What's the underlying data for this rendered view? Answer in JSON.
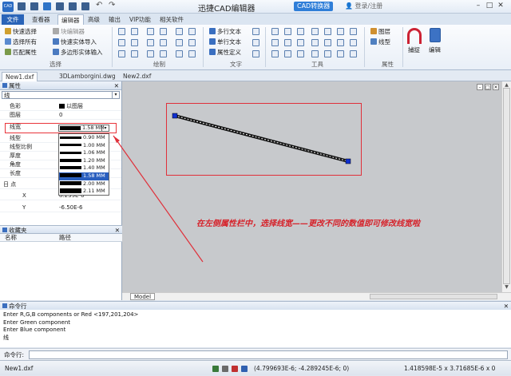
{
  "title_bar": {
    "app_icon_label": "CAD",
    "title": "迅捷CAD编辑器",
    "convert_button": "CAD转换器",
    "login": "登录/注册",
    "minimize": "–",
    "maximize": "□",
    "close": "✕"
  },
  "menu_tabs": [
    "文件",
    "查看器",
    "编辑器",
    "高级",
    "输出",
    "VIP功能",
    "相关软件"
  ],
  "ribbon": {
    "select_group": {
      "items": [
        "快速选择",
        "选择所有",
        "匹配属性"
      ],
      "items2": [
        "块编辑器",
        "快速实体导入",
        "多边形实体输入"
      ],
      "label": "选择"
    },
    "draw_group_label": "绘制",
    "text_group": {
      "items": [
        "多行文本",
        "单行文本",
        "属性定义"
      ],
      "label": "文字"
    },
    "tools_group_label": "工具",
    "property_group": {
      "items": [
        "图层",
        "线型"
      ],
      "label": "属性"
    },
    "snap_label": "捕捉",
    "edit_label": "编辑"
  },
  "document_tabs": [
    "New1.dxf",
    "3DLamborgini.dwg",
    "New2.dxf"
  ],
  "properties_panel": {
    "header": "属性",
    "object_type": "线",
    "rows": [
      {
        "key": "色彩",
        "value": "以图层"
      },
      {
        "key": "图层",
        "value": "0"
      },
      {
        "key": "线宽",
        "value": "1.58 MM"
      },
      {
        "key": "线型",
        "value": ""
      },
      {
        "key": "线型比例",
        "value": ""
      },
      {
        "key": "厚度",
        "value": ""
      },
      {
        "key": "角度",
        "value": ""
      },
      {
        "key": "长度",
        "value": ""
      },
      {
        "key": "日 点",
        "value": ""
      },
      {
        "key": "X",
        "value": "8.239E-6"
      },
      {
        "key": "Y",
        "value": "-6.50E-6"
      }
    ],
    "lineweight_options": [
      "0.90 MM",
      "1.00 MM",
      "1.06 MM",
      "1.20 MM",
      "1.40 MM",
      "1.58 MM",
      "2.00 MM",
      "2.11 MM"
    ],
    "lineweight_selected": "1.58 MM"
  },
  "favorites_panel": {
    "header": "收藏夹",
    "columns": [
      "名称",
      "路径"
    ]
  },
  "canvas": {
    "model_tab": "Model",
    "annotation": "在左侧属性栏中，选择线宽——更改不同的数值即可修改线宽啦"
  },
  "command_panel": {
    "header": "命令行",
    "lines": [
      "Enter R,G,B components or Red <197,201,204>",
      "Enter Green component",
      "Enter Blue component",
      "线"
    ],
    "input_label": "命令行:"
  },
  "status_bar": {
    "file": "New1.dxf",
    "coords": "(4.799693E-6; -4.289245E-6; 0)",
    "size": "1.418598E-5 x 3.71685E-6 x 0"
  },
  "colors": {
    "accent": "#2a64b8",
    "annotation_red": "#d6222a",
    "canvas_bg": "#c7c9cc"
  }
}
